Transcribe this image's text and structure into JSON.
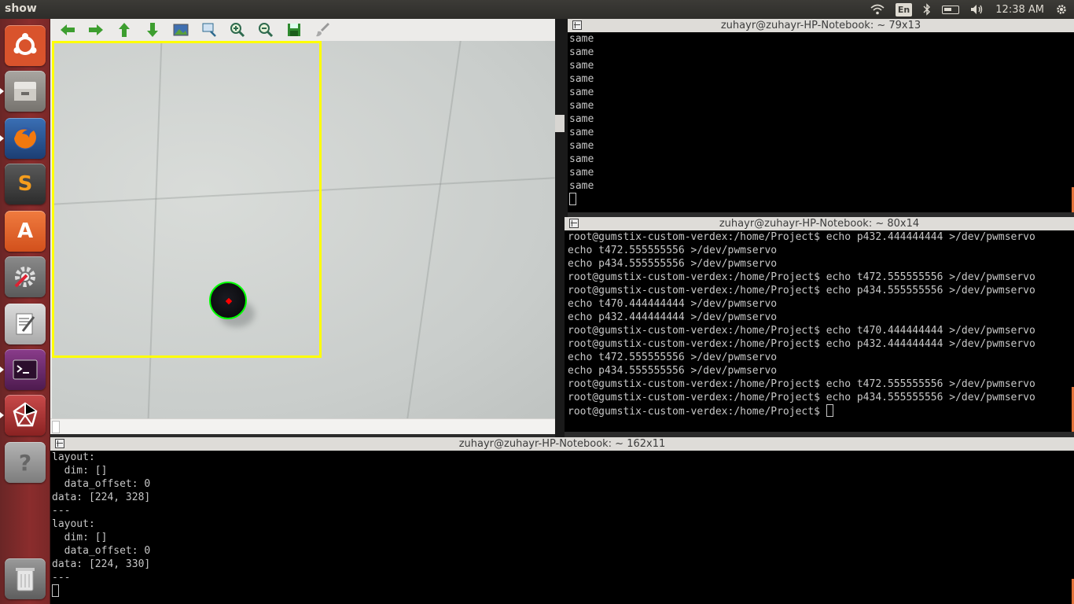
{
  "top_panel": {
    "app_title": "show",
    "language": "En",
    "clock": "12:38 AM",
    "icons": [
      "wifi-icon",
      "bluetooth-icon",
      "battery-icon",
      "volume-icon",
      "settings-gear-icon"
    ]
  },
  "launcher": {
    "items": [
      {
        "name": "ubuntu-dash",
        "color": "#d9532c"
      },
      {
        "name": "files",
        "color": "#8d8a85"
      },
      {
        "name": "firefox",
        "color": "#e66000"
      },
      {
        "name": "sublime-text",
        "color": "#4a4a4a",
        "glyph": "S"
      },
      {
        "name": "software-center",
        "color": "#e2602f",
        "glyph": "A"
      },
      {
        "name": "system-settings",
        "color": "#7a7a7a"
      },
      {
        "name": "text-editor",
        "color": "#9a9a9a"
      },
      {
        "name": "terminal",
        "color": "#6c2a6d"
      },
      {
        "name": "network-app",
        "color": "#b23a3a"
      },
      {
        "name": "help",
        "color": "#8a8a8a",
        "glyph": "?"
      },
      {
        "name": "trash",
        "color": "#6a6a6a"
      }
    ]
  },
  "viewer": {
    "toolbar": [
      "back",
      "forward",
      "up",
      "down",
      "image",
      "zoom-fit",
      "zoom-in",
      "zoom-out",
      "save",
      "brush"
    ],
    "accent": "#3d9e2f"
  },
  "term1": {
    "title": "zuhayr@zuhayr-HP-Notebook: ~ 79x13",
    "lines": [
      "same",
      "same",
      "same",
      "same",
      "same",
      "same",
      "same",
      "same",
      "same",
      "same",
      "same",
      "same"
    ]
  },
  "term2": {
    "title": "zuhayr@zuhayr-HP-Notebook: ~ 80x14",
    "lines": [
      "root@gumstix-custom-verdex:/home/Project$ echo p432.444444444 >/dev/pwmservo",
      "echo t472.555555556 >/dev/pwmservo",
      "echo p434.555555556 >/dev/pwmservo",
      "root@gumstix-custom-verdex:/home/Project$ echo t472.555555556 >/dev/pwmservo",
      "root@gumstix-custom-verdex:/home/Project$ echo p434.555555556 >/dev/pwmservo",
      "echo t470.444444444 >/dev/pwmservo",
      "echo p432.444444444 >/dev/pwmservo",
      "root@gumstix-custom-verdex:/home/Project$ echo t470.444444444 >/dev/pwmservo",
      "root@gumstix-custom-verdex:/home/Project$ echo p432.444444444 >/dev/pwmservo",
      "echo t472.555555556 >/dev/pwmservo",
      "echo p434.555555556 >/dev/pwmservo",
      "root@gumstix-custom-verdex:/home/Project$ echo t472.555555556 >/dev/pwmservo",
      "root@gumstix-custom-verdex:/home/Project$ echo p434.555555556 >/dev/pwmservo"
    ],
    "prompt": "root@gumstix-custom-verdex:/home/Project$ "
  },
  "term3": {
    "title": "zuhayr@zuhayr-HP-Notebook: ~ 162x11",
    "lines": [
      "layout:",
      "  dim: []",
      "  data_offset: 0",
      "data: [224, 328]",
      "---",
      "layout:",
      "  dim: []",
      "  data_offset: 0",
      "data: [224, 330]",
      "---"
    ]
  }
}
